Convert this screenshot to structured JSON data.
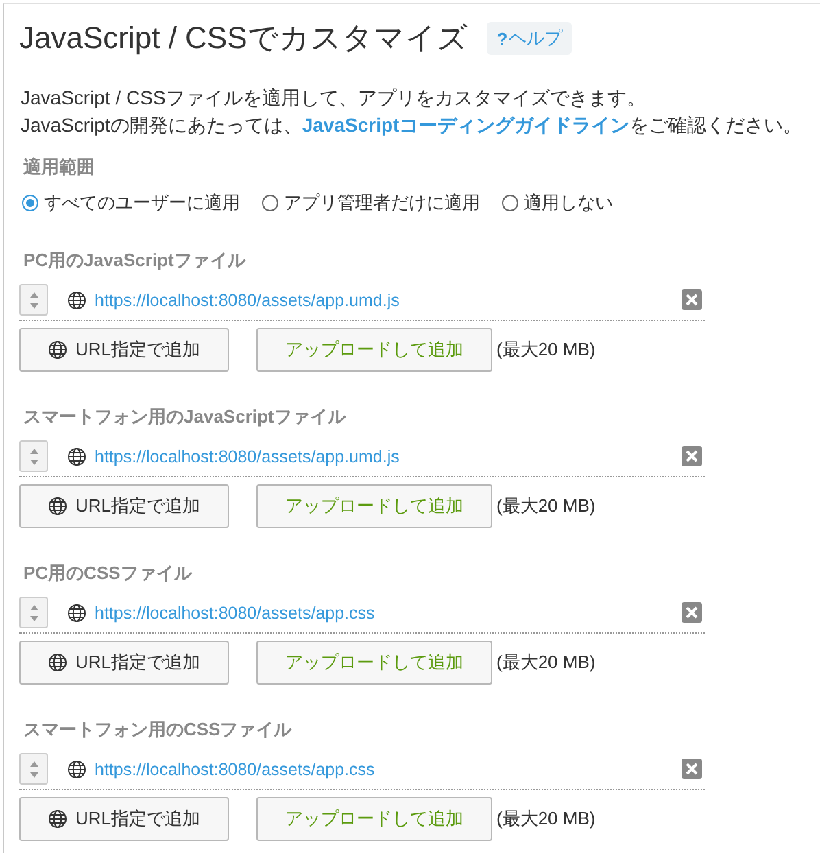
{
  "title": "JavaScript / CSSでカスタマイズ",
  "help": {
    "icon": "?",
    "label": "ヘルプ"
  },
  "description": {
    "line1": "JavaScript / CSSファイルを適用して、アプリをカスタマイズできます。",
    "before": "JavaScriptの開発にあたっては、",
    "link": "JavaScriptコーディングガイドライン",
    "after": "をご確認ください。"
  },
  "scope": {
    "label": "適用範囲",
    "options": [
      {
        "label": "すべてのユーザーに適用",
        "selected": true
      },
      {
        "label": "アプリ管理者だけに適用",
        "selected": false
      },
      {
        "label": "適用しない",
        "selected": false
      }
    ]
  },
  "sections": [
    {
      "label": "PC用のJavaScriptファイル",
      "files": [
        {
          "url": "https://localhost:8080/assets/app.umd.js"
        }
      ],
      "url_button": "URL指定で追加",
      "upload_button": "アップロードして追加",
      "limit": "(最大20 MB)"
    },
    {
      "label": "スマートフォン用のJavaScriptファイル",
      "files": [
        {
          "url": "https://localhost:8080/assets/app.umd.js"
        }
      ],
      "url_button": "URL指定で追加",
      "upload_button": "アップロードして追加",
      "limit": "(最大20 MB)"
    },
    {
      "label": "PC用のCSSファイル",
      "files": [
        {
          "url": "https://localhost:8080/assets/app.css"
        }
      ],
      "url_button": "URL指定で追加",
      "upload_button": "アップロードして追加",
      "limit": "(最大20 MB)"
    },
    {
      "label": "スマートフォン用のCSSファイル",
      "files": [
        {
          "url": "https://localhost:8080/assets/app.css"
        }
      ],
      "url_button": "URL指定で追加",
      "upload_button": "アップロードして追加",
      "limit": "(最大20 MB)"
    }
  ]
}
